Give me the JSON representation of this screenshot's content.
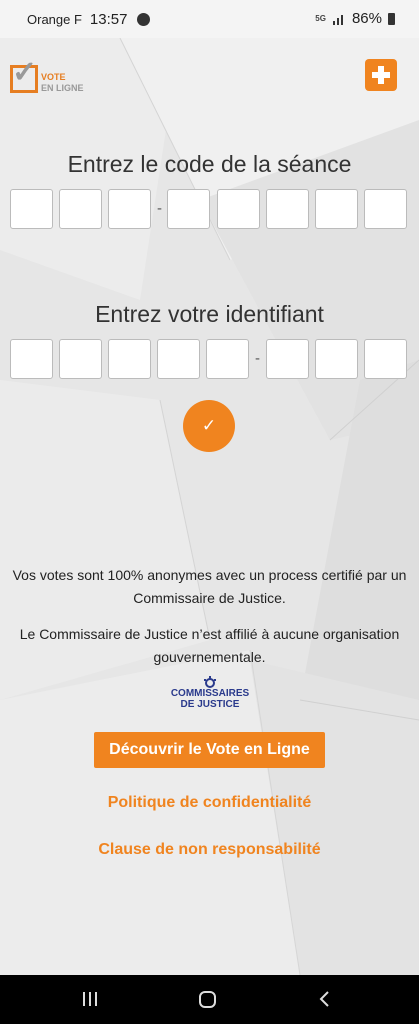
{
  "status_bar": {
    "carrier": "Orange F",
    "time": "13:57",
    "network": "5G",
    "battery": "86%"
  },
  "header": {
    "logo_line1": "VOTE",
    "logo_line2": "EN LIGNE",
    "plus_icon": "plus-icon"
  },
  "session": {
    "title": "Entrez le code de la séance",
    "separator": "-"
  },
  "identifier": {
    "title": "Entrez votre identifiant",
    "separator": "-"
  },
  "submit": {
    "label": "✓"
  },
  "info": {
    "anonymity": "Vos votes sont 100% anonymes avec un process certifié par un Commissaire de Justice.",
    "independence": "Le Commissaire de Justice n’est affilié à aucune organisation gouvernementale."
  },
  "cj_logo": {
    "line1": "COMMISSAIRES",
    "line2": "DE JUSTICE"
  },
  "links": {
    "discover": "Découvrir le Vote en Ligne",
    "privacy": "Politique de confidentialité",
    "disclaimer": "Clause de non responsabilité"
  },
  "colors": {
    "accent": "#f0841f",
    "cj_blue": "#2a3a8c"
  },
  "nav": {
    "icons": [
      "recent-apps-icon",
      "home-icon",
      "back-icon"
    ]
  }
}
